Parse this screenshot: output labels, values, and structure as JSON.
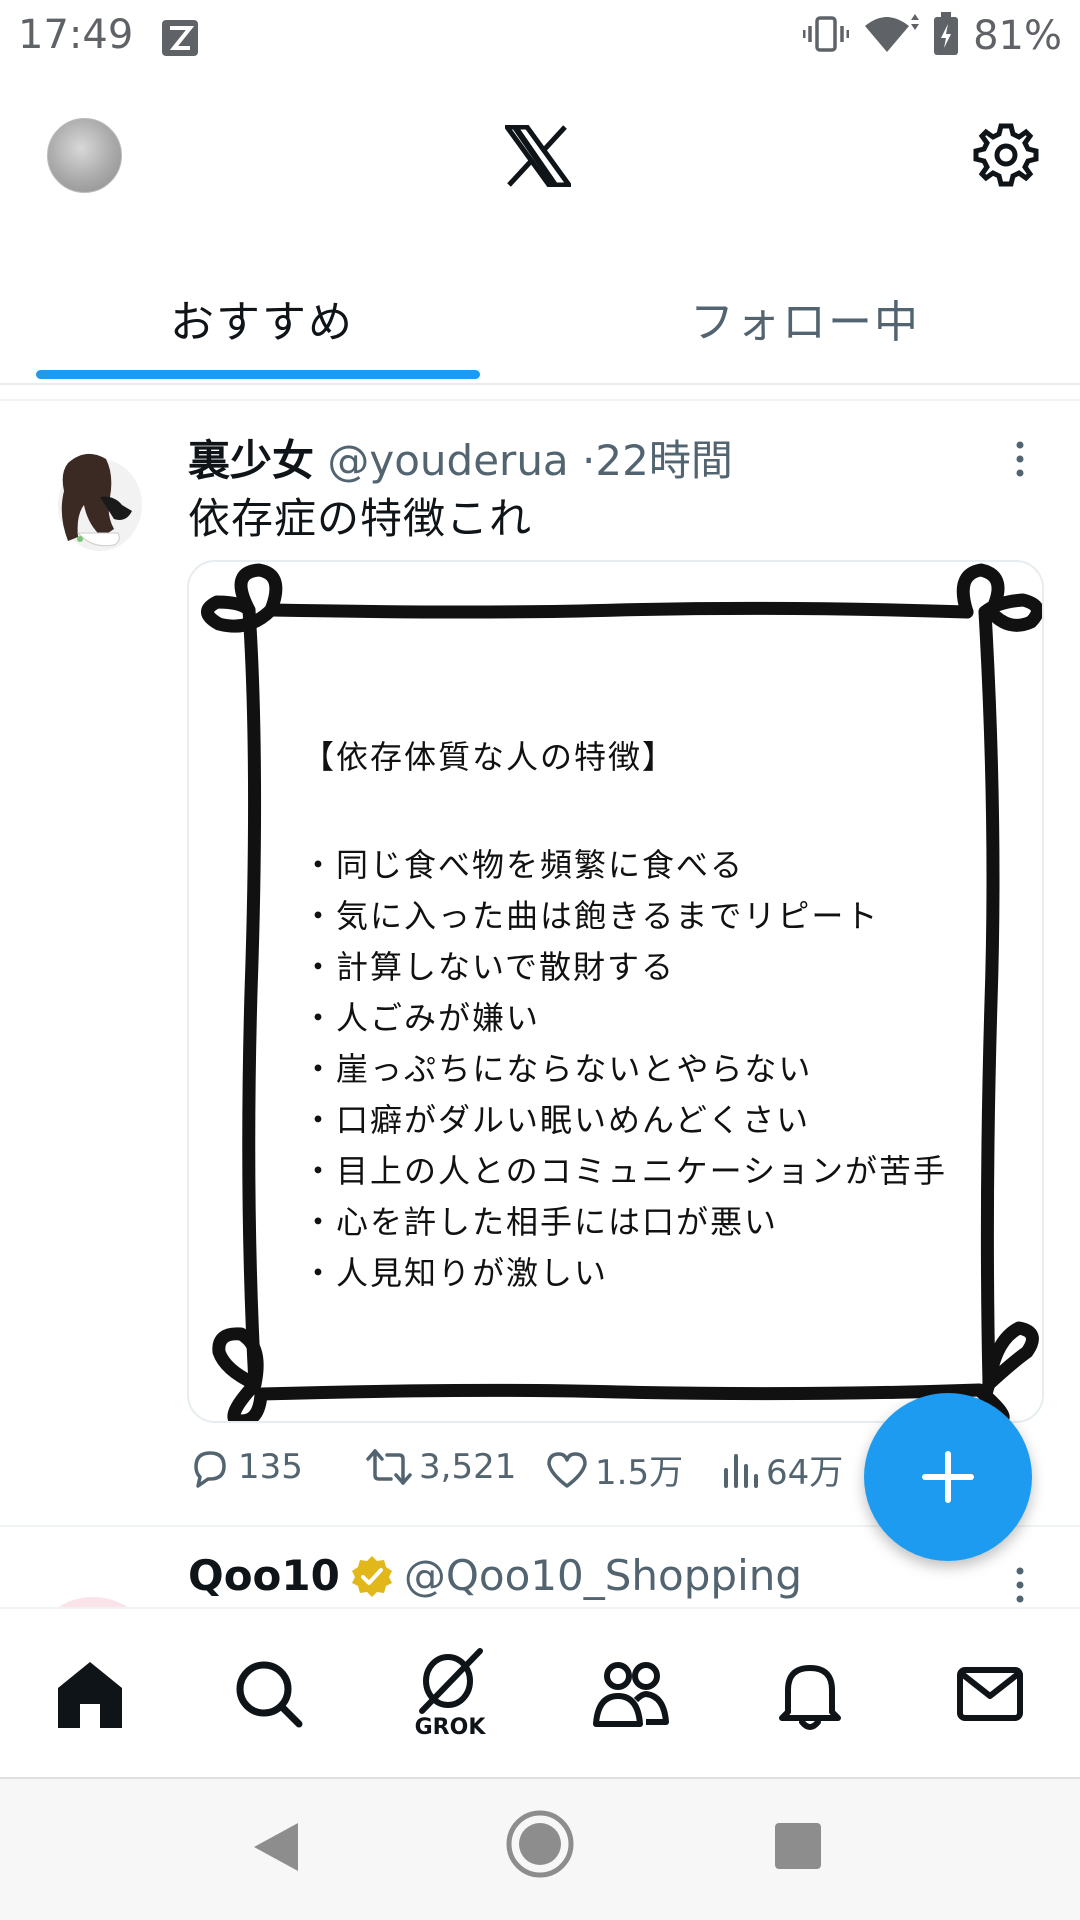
{
  "status_bar": {
    "time": "17:49",
    "battery": "81%"
  },
  "header": {
    "logo": "x-logo-icon",
    "settings": "gear-icon"
  },
  "tabs": [
    {
      "label": "おすすめ",
      "active": true
    },
    {
      "label": "フォロー中",
      "active": false
    }
  ],
  "tweet": {
    "name": "裏少女",
    "handle": "@youderua",
    "separator": "·",
    "time": "22時間",
    "text": "依存症の特徴これ",
    "media": {
      "title": "【依存体質な人の特徴】",
      "items": [
        "・同じ食べ物を頻繁に食べる",
        "・気に入った曲は飽きるまでリピート",
        "・計算しないで散財する",
        "・人ごみが嫌い",
        "・崖っぷちにならないとやらない",
        "・口癖がダルい眠いめんどくさい",
        "・目上の人とのコミュニケーションが苦手",
        "・心を許した相手には口が悪い",
        "・人見知りが激しい"
      ]
    },
    "stats": {
      "replies": "135",
      "retweets": "3,521",
      "likes": "1.5万",
      "views": "64万"
    }
  },
  "next_tweet": {
    "name": "Qoo10",
    "handle": "@Qoo10_Shopping"
  },
  "bottom_nav": {
    "grok_label": "GROK"
  },
  "colors": {
    "accent": "#1d9bf0",
    "text_primary": "#0f1419",
    "text_secondary": "#536471",
    "verified_gold": "#e2b719"
  }
}
